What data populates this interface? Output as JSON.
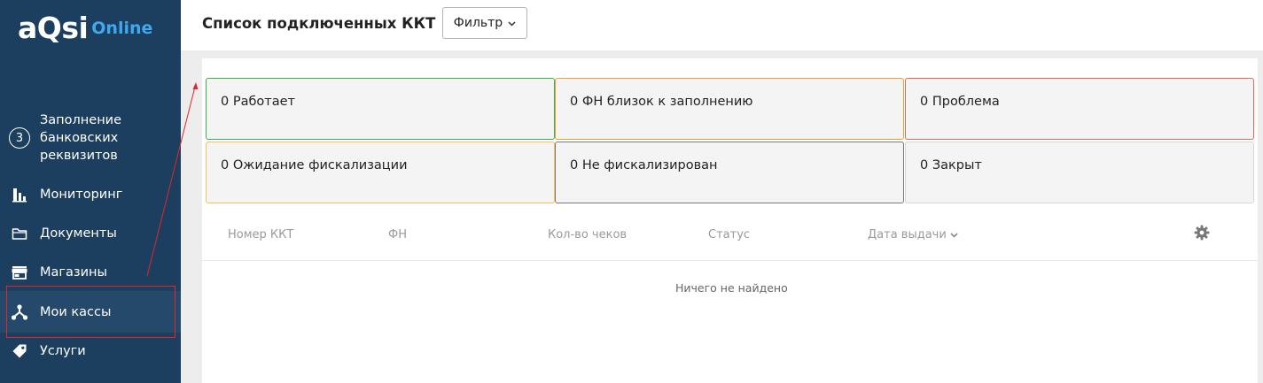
{
  "logo": {
    "main": "aQsi",
    "online": "Online"
  },
  "sidebar": {
    "items": [
      {
        "step": "3",
        "label_lines": [
          "Заполнение",
          "банковских",
          "реквизитов"
        ],
        "icon": "step-number-icon"
      },
      {
        "label": "Мониторинг",
        "icon": "bar-chart-icon"
      },
      {
        "label": "Документы",
        "icon": "folder-icon"
      },
      {
        "label": "Магазины",
        "icon": "store-icon"
      },
      {
        "label": "Мои кассы",
        "icon": "network-icon",
        "active": true
      },
      {
        "label": "Услуги",
        "icon": "tag-icon"
      }
    ]
  },
  "header": {
    "title": "Список подключенных ККТ",
    "filter_label": "Фильтр"
  },
  "status_cards": [
    {
      "count": "0",
      "label": "Работает",
      "color": "#3fae49"
    },
    {
      "count": "0",
      "label": "ФН близок к заполнению",
      "color": "#f0a030"
    },
    {
      "count": "0",
      "label": "Проблема",
      "color": "#e0675a"
    },
    {
      "count": "0",
      "label": "Ожидание фискализации",
      "color": "#f2c060"
    },
    {
      "count": "0",
      "label": "Не фискализирован",
      "color": "#7a7a7a"
    },
    {
      "count": "0",
      "label": "Закрыт",
      "color": "#d0d0d0"
    }
  ],
  "table": {
    "columns": [
      "Номер ККТ",
      "ФН",
      "Кол-во чеков",
      "Статус",
      "Дата выдачи"
    ],
    "empty_text": "Ничего не найдено"
  },
  "colors": {
    "sidebar_bg": "#1c3f5f",
    "accent": "#3ea8f0",
    "annotation": "#e0262a"
  }
}
